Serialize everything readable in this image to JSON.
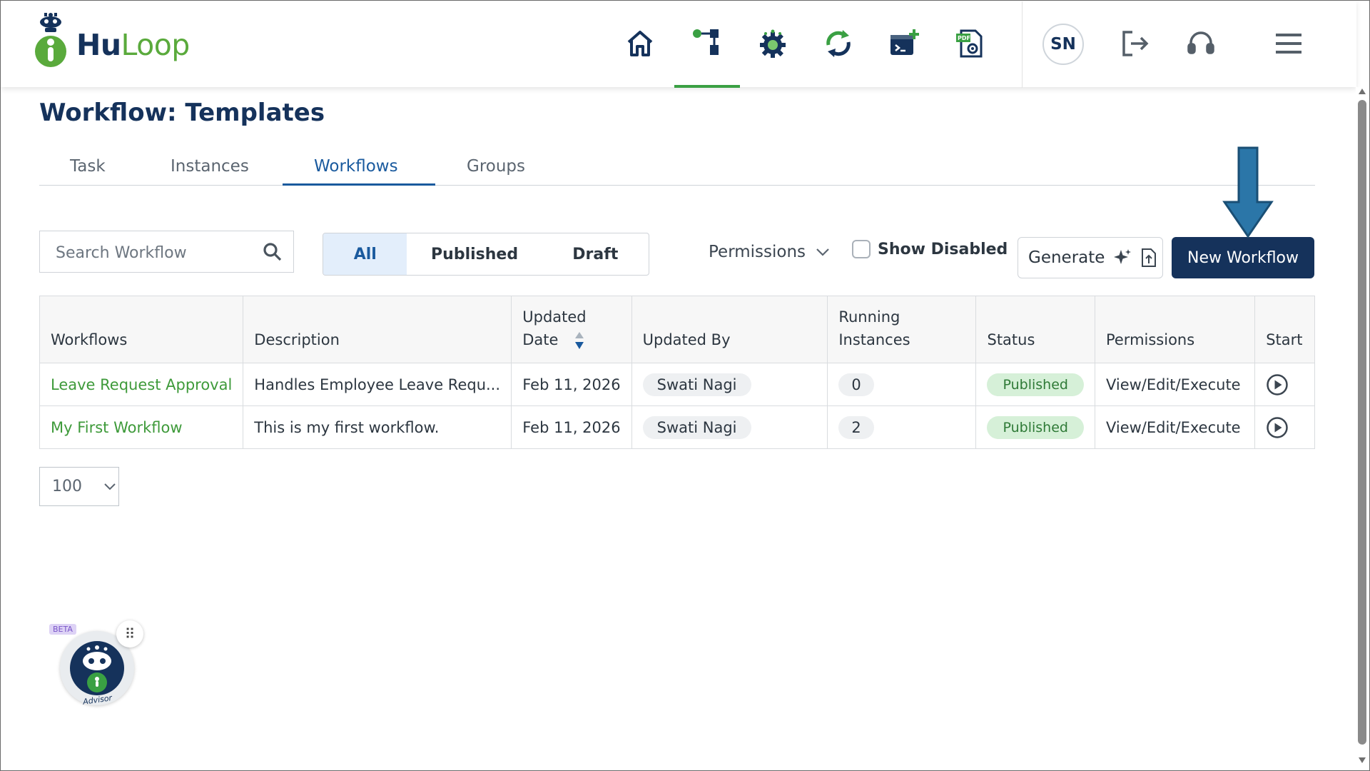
{
  "app": {
    "brand_part1": "Hu",
    "brand_part2": "Loop",
    "user_initials": "SN"
  },
  "nav": {
    "icons": [
      "home-icon",
      "workflow-icon",
      "automation-gear-icon",
      "sync-icon",
      "terminal-add-icon",
      "pdf-settings-icon"
    ],
    "active": "workflow-icon"
  },
  "header_actions": [
    "logout-icon",
    "support-headset-icon",
    "menu-icon"
  ],
  "page": {
    "title": "Workflow: Templates"
  },
  "tabs": [
    {
      "label": "Task"
    },
    {
      "label": "Instances"
    },
    {
      "label": "Workflows",
      "active": true
    },
    {
      "label": "Groups"
    }
  ],
  "toolbar": {
    "search_placeholder": "Search Workflow",
    "filters": [
      "All",
      "Published",
      "Draft"
    ],
    "active_filter": "All",
    "permissions_label": "Permissions",
    "show_disabled_label": "Show Disabled",
    "show_disabled_checked": false,
    "generate_label": "Generate",
    "new_workflow_label": "New Workflow"
  },
  "table": {
    "headers": {
      "workflows": "Workflows",
      "description": "Description",
      "updated_date_1": "Updated",
      "updated_date_2": "Date",
      "updated_by": "Updated By",
      "running_1": "Running",
      "running_2": "Instances",
      "status": "Status",
      "permissions": "Permissions",
      "start": "Start"
    },
    "rows": [
      {
        "workflow": "Leave Request Approval",
        "description": "Handles Employee Leave Requ...",
        "updated_date": "Feb 11, 2026",
        "updated_by": "Swati Nagi",
        "running_instances": "0",
        "status": "Published",
        "permissions": "View/Edit/Execute"
      },
      {
        "workflow": "My First Workflow",
        "description": "This is my first workflow.",
        "updated_date": "Feb 11, 2026",
        "updated_by": "Swati Nagi",
        "running_instances": "2",
        "status": "Published",
        "permissions": "View/Edit/Execute"
      }
    ]
  },
  "pagination": {
    "page_size": "100"
  },
  "advisor": {
    "badge": "BETA",
    "label": "Advisor"
  },
  "colors": {
    "primary": "#15325b",
    "accent_green": "#3aa043",
    "link_blue": "#1a5a9e",
    "status_bg": "#d6f0d8",
    "annotation_arrow": "#2b76a8"
  }
}
